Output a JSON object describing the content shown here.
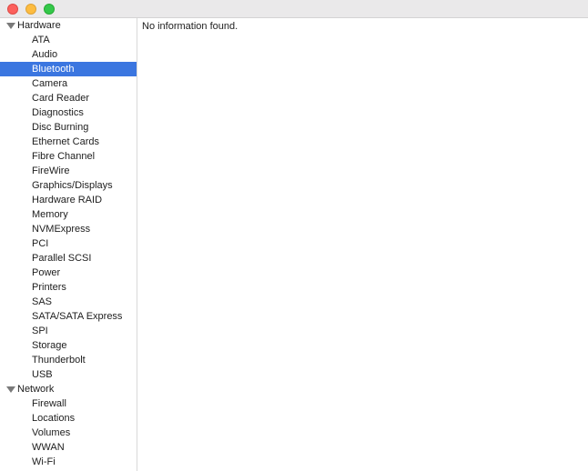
{
  "window": {
    "traffic_lights": {
      "close": "#fc605c",
      "minimize": "#fdbc40",
      "zoom": "#34c84a"
    }
  },
  "sidebar": {
    "selected_color": "#3b76e0",
    "groups": [
      {
        "label": "Hardware",
        "expanded": true,
        "items": [
          "ATA",
          "Audio",
          "Bluetooth",
          "Camera",
          "Card Reader",
          "Diagnostics",
          "Disc Burning",
          "Ethernet Cards",
          "Fibre Channel",
          "FireWire",
          "Graphics/Displays",
          "Hardware RAID",
          "Memory",
          "NVMExpress",
          "PCI",
          "Parallel SCSI",
          "Power",
          "Printers",
          "SAS",
          "SATA/SATA Express",
          "SPI",
          "Storage",
          "Thunderbolt",
          "USB"
        ]
      },
      {
        "label": "Network",
        "expanded": true,
        "items": [
          "Firewall",
          "Locations",
          "Volumes",
          "WWAN",
          "Wi-Fi"
        ]
      }
    ],
    "selected_item": "Bluetooth"
  },
  "content": {
    "message": "No information found."
  }
}
